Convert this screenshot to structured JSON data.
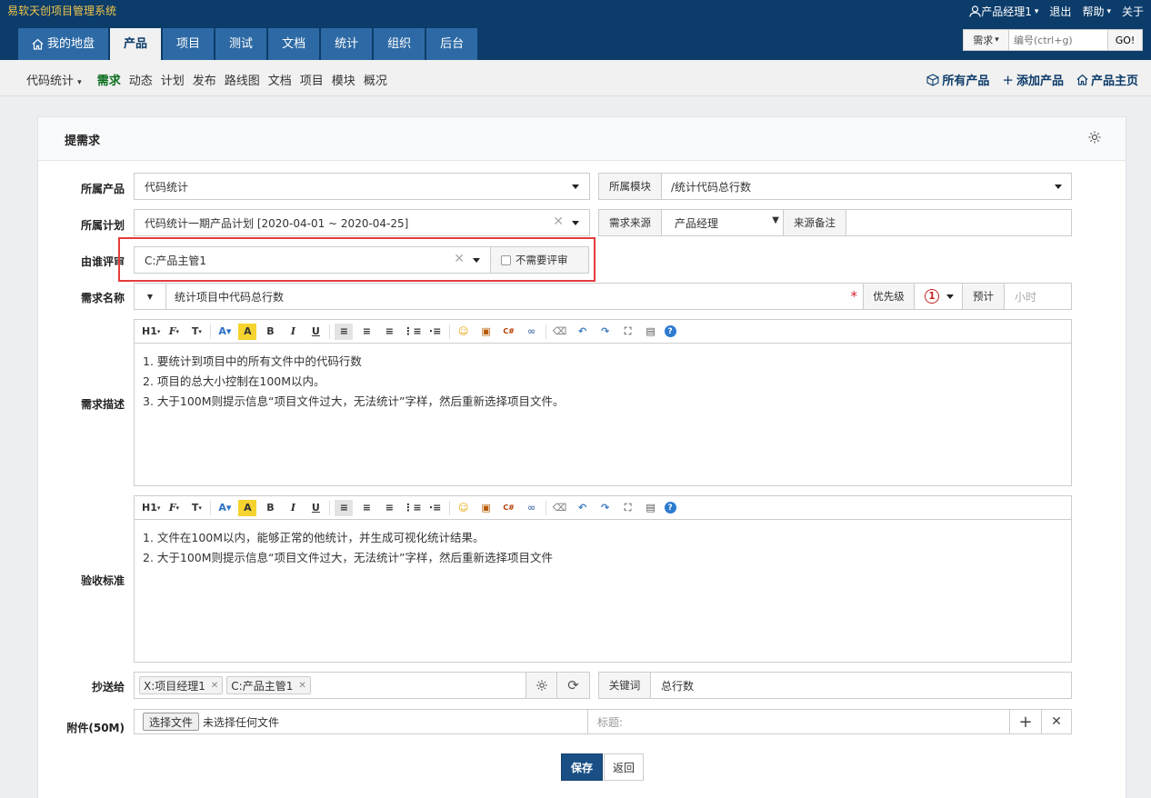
{
  "app": {
    "brand": "易软天创项目管理系统"
  },
  "user_menu": {
    "user": "产品经理1",
    "logout": "退出",
    "help": "帮助",
    "about": "关于"
  },
  "tabs": [
    {
      "label": "我的地盘"
    },
    {
      "label": "产品"
    },
    {
      "label": "项目"
    },
    {
      "label": "测试"
    },
    {
      "label": "文档"
    },
    {
      "label": "统计"
    },
    {
      "label": "组织"
    },
    {
      "label": "后台"
    }
  ],
  "search": {
    "type": "需求",
    "placeholder": "编号(ctrl+g)",
    "go": "GO!"
  },
  "subnav": {
    "product_select": "代码统计",
    "items": [
      "需求",
      "动态",
      "计划",
      "发布",
      "路线图",
      "文档",
      "项目",
      "模块",
      "概况"
    ],
    "right": {
      "all_products": "所有产品",
      "add_product": "添加产品",
      "product_home": "产品主页"
    }
  },
  "panel": {
    "title": "提需求"
  },
  "form": {
    "product": {
      "label": "所属产品",
      "value": "代码统计"
    },
    "module": {
      "label": "所属模块",
      "value": "/统计代码总行数"
    },
    "plan": {
      "label": "所属计划",
      "value": "代码统计一期产品计划 [2020-04-01 ~ 2020-04-25]"
    },
    "source": {
      "label": "需求来源",
      "value": "产品经理"
    },
    "source_note": {
      "label": "来源备注",
      "value": ""
    },
    "reviewer": {
      "label": "由谁评审",
      "value": "C:产品主管1",
      "no_review": "不需要评审"
    },
    "title": {
      "label": "需求名称",
      "value": "统计项目中代码总行数"
    },
    "priority": {
      "label": "优先级",
      "value": "1"
    },
    "estimate": {
      "label": "预计",
      "placeholder": "小时"
    },
    "spec": {
      "label": "需求描述",
      "lines": [
        "1. 要统计到项目中的所有文件中的代码行数",
        "2. 项目的总大小控制在100M以内。",
        "3. 大于100M则提示信息“项目文件过大，无法统计”字样，然后重新选择项目文件。"
      ]
    },
    "verify": {
      "label": "验收标准",
      "lines": [
        "1. 文件在100M以内，能够正常的他统计，并生成可视化统计结果。",
        "2. 大于100M则提示信息“项目文件过大，无法统计”字样，然后重新选择项目文件"
      ]
    },
    "mailto": {
      "label": "抄送给",
      "chips": [
        "X:项目经理1",
        "C:产品主管1"
      ]
    },
    "keywords": {
      "label": "关键词",
      "value": "总行数"
    },
    "files": {
      "label": "附件(50M)",
      "choose": "选择文件",
      "none": "未选择任何文件",
      "title_placeholder": "标题:"
    },
    "toolbar": {
      "heading": "H1",
      "font": "F",
      "size": "T"
    }
  },
  "actions": {
    "save": "保存",
    "back": "返回"
  }
}
